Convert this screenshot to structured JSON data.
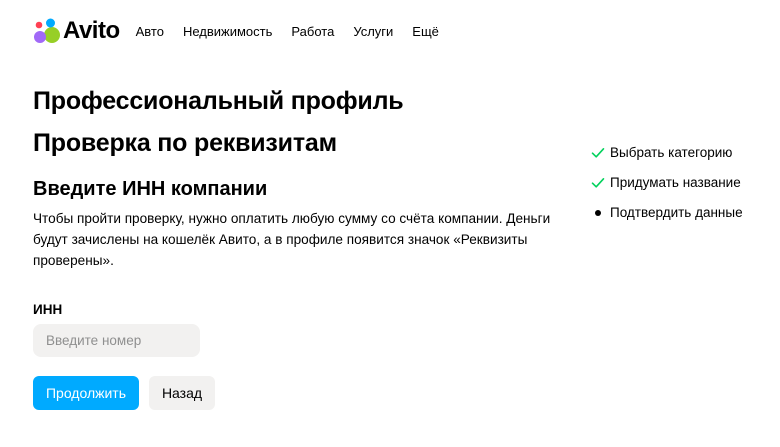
{
  "header": {
    "logo_text": "Avito",
    "nav": [
      "Авто",
      "Недвижимость",
      "Работа",
      "Услуги",
      "Ещё"
    ]
  },
  "main": {
    "title": "Профессиональный профиль",
    "subtitle": "Проверка по реквизитам",
    "section_title": "Введите ИНН компании",
    "description": "Чтобы пройти проверку, нужно оплатить любую сумму со счёта компании. Деньги будут зачислены на кошелёк Авито, а в профиле появится значок «Реквизиты проверены».",
    "inn_label": "ИНН",
    "inn_placeholder": "Введите номер",
    "inn_value": "",
    "continue_label": "Продолжить",
    "back_label": "Назад"
  },
  "steps": [
    {
      "label": "Выбрать категорию",
      "status": "done",
      "icon": "check-icon"
    },
    {
      "label": "Придумать название",
      "status": "done",
      "icon": "check-icon"
    },
    {
      "label": "Подтвердить данные",
      "status": "current",
      "icon": "bullet-icon"
    }
  ],
  "colors": {
    "accent": "#00aaff",
    "check": "#02d15c",
    "input_bg": "#f2f1f0",
    "logo_green": "#97cf26",
    "logo_blue": "#0af",
    "logo_red": "#ff4053",
    "logo_purple": "#a169f7"
  }
}
